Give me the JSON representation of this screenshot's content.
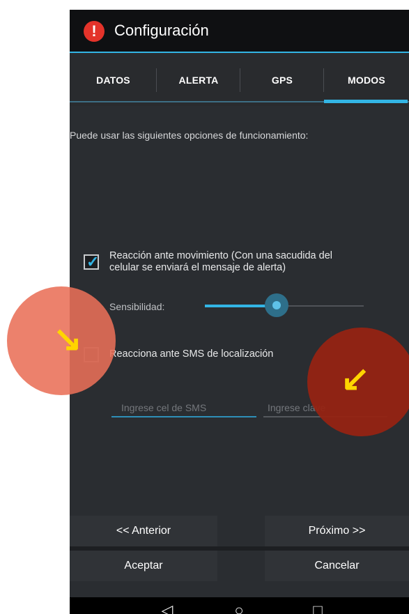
{
  "header": {
    "title": "Configuración",
    "icon": "alert-icon"
  },
  "tabs": [
    {
      "label": "DATOS",
      "active": false
    },
    {
      "label": "ALERTA",
      "active": false
    },
    {
      "label": "GPS",
      "active": false
    },
    {
      "label": "MODOS",
      "active": true
    }
  ],
  "content": {
    "description": "Puede usar las siguientes opciones de funcionamiento:",
    "option_motion": {
      "checked": true,
      "line1": "Reacción ante movimiento (Con una sacudida del",
      "line2": "celular se enviará el mensaje de alerta)"
    },
    "sensitivity": {
      "label": "Sensibilidad:",
      "value": 0.45
    },
    "option_sms": {
      "checked": false,
      "label": "Reacciona ante SMS de localización"
    },
    "sms_phone": {
      "placeholder": "Ingrese cel de SMS"
    },
    "sms_key": {
      "placeholder": "Ingrese clave"
    }
  },
  "buttons": {
    "previous": "<< Anterior",
    "next": "Próximo >>",
    "accept": "Aceptar",
    "cancel": "Cancelar"
  },
  "navbar": {
    "back_icon": "◁",
    "home_icon": "○",
    "recents_icon": "□"
  },
  "annotations": {
    "left_arrow": "↘",
    "right_arrow": "↙",
    "circle_color_left": "#ec7a63",
    "circle_color_right": "#9a2513",
    "arrow_color": "#ffd500"
  },
  "colors": {
    "accent": "#33b5e5",
    "alert_red": "#e4332a"
  }
}
